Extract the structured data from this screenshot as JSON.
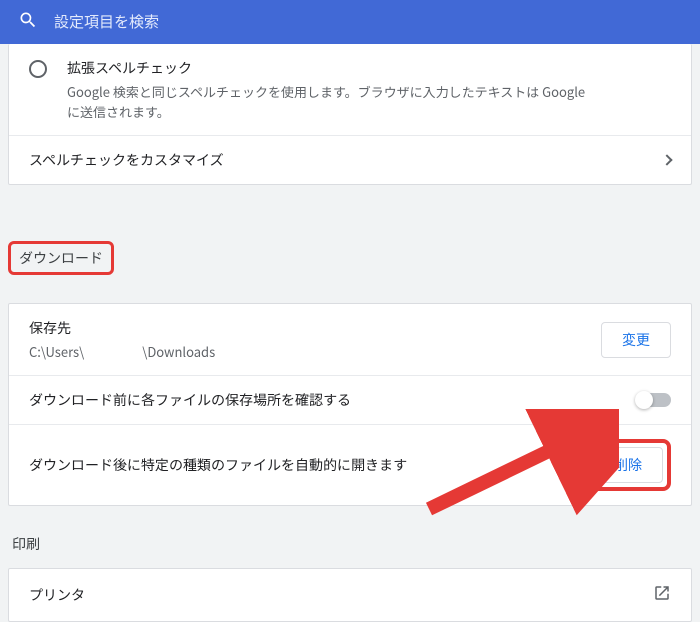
{
  "search": {
    "placeholder": "設定項目を検索"
  },
  "spellcheck": {
    "option_title": "拡張スペルチェック",
    "option_desc": "Google 検索と同じスペルチェックを使用します。ブラウザに入力したテキストは Google に送信されます。",
    "customize_label": "スペルチェックをカスタマイズ"
  },
  "downloads": {
    "heading": "ダウンロード",
    "location_label": "保存先",
    "location_prefix": "C:\\Users\\",
    "location_suffix": "\\Downloads",
    "change_button": "変更",
    "ask_label": "ダウンロード前に各ファイルの保存場所を確認する",
    "autoopen_label": "ダウンロード後に特定の種類のファイルを自動的に開きます",
    "remove_button": "削除"
  },
  "printing": {
    "heading": "印刷",
    "printers_label": "プリンタ"
  }
}
